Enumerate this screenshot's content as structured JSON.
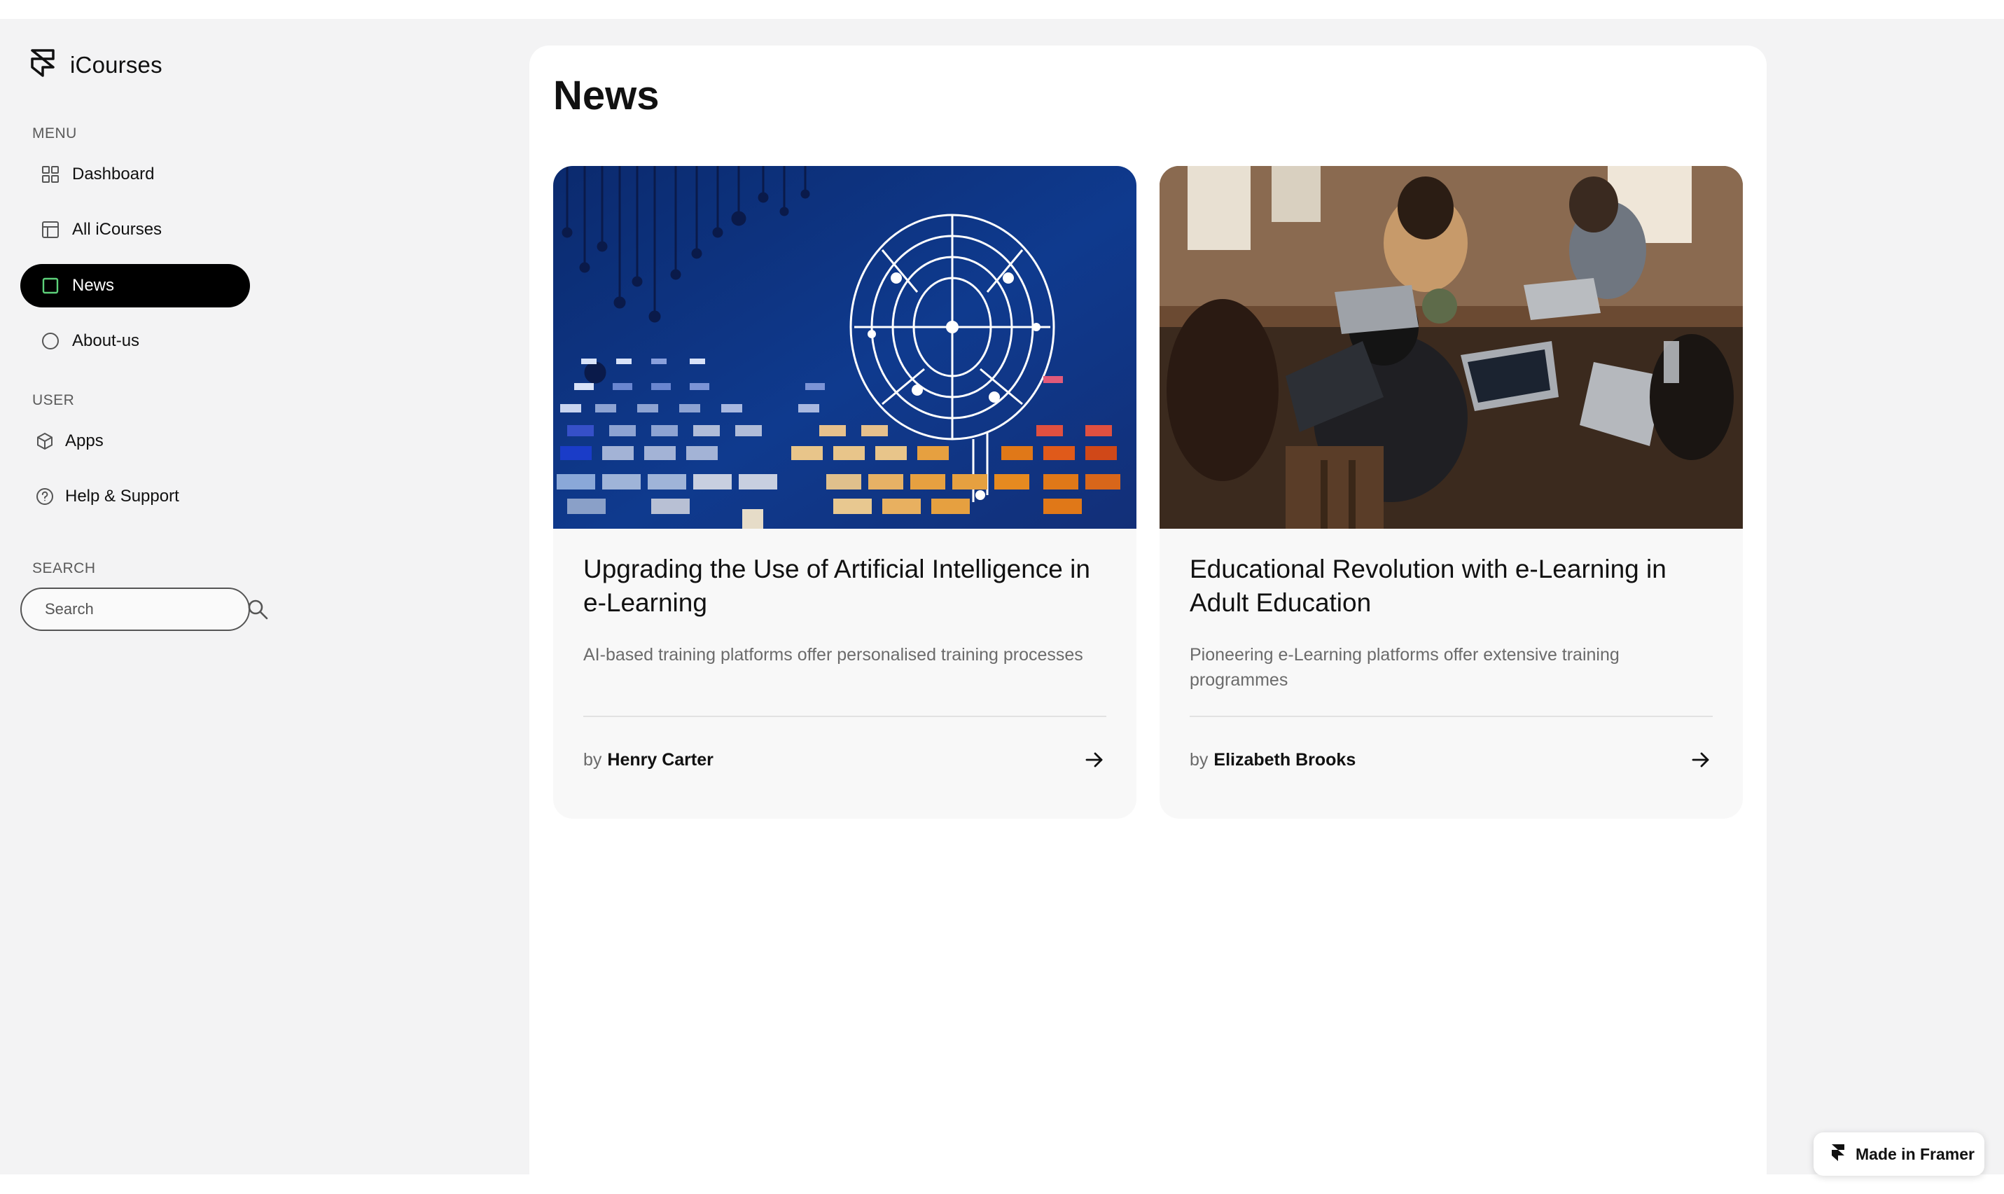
{
  "app": {
    "brand_name": "iCourses"
  },
  "sidebar": {
    "menu_label": "MENU",
    "menu_items": [
      {
        "label": "Dashboard",
        "icon": "grid-icon"
      },
      {
        "label": "All iCourses",
        "icon": "layout-icon"
      },
      {
        "label": "News",
        "icon": "square-icon",
        "active": true
      },
      {
        "label": "About-us",
        "icon": "circle-icon"
      }
    ],
    "user_label": "USER",
    "user_items": [
      {
        "label": "Apps",
        "icon": "cube-icon"
      },
      {
        "label": "Help & Support",
        "icon": "help-circle-icon"
      }
    ],
    "search_label": "SEARCH",
    "search_placeholder": "Search"
  },
  "main": {
    "title": "News",
    "cards": [
      {
        "title": "Upgrading the Use of Artificial Intelligence in e-Learning",
        "description": "AI-based training platforms offer personalised training processes",
        "by": "by",
        "author": "Henry Carter",
        "image": "ai-circuit-brain-image"
      },
      {
        "title": "Educational Revolution with e-Learning in Adult Education",
        "description": "Pioneering e-Learning platforms offer extensive training programmes",
        "by": "by",
        "author": "Elizabeth Brooks",
        "image": "people-with-laptops-photo"
      }
    ]
  },
  "badge": {
    "label": "Made in Framer"
  },
  "colors": {
    "app_background": "#f3f3f4",
    "panel_background": "#ffffff",
    "card_background": "#f8f8f8",
    "active_nav": "#000000",
    "active_icon_accent": "#5dd17a",
    "muted_text": "#6b6b6b"
  }
}
